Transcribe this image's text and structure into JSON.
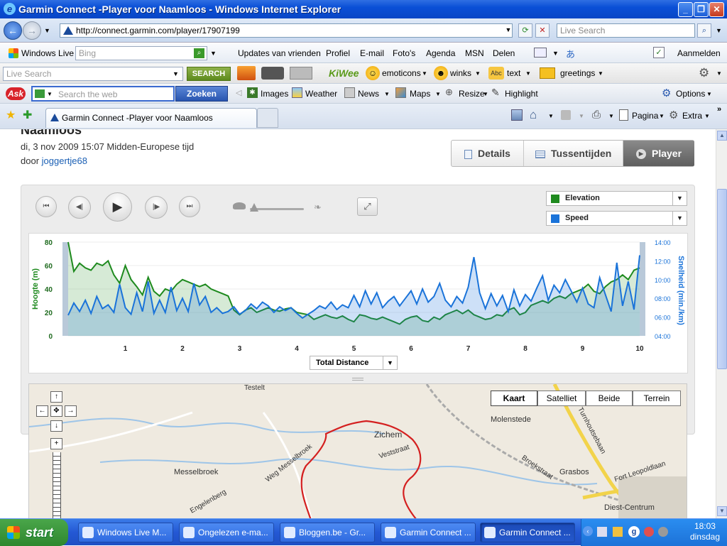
{
  "window": {
    "title": "Garmin Connect -Player voor Naamloos - Windows Internet Explorer"
  },
  "browser": {
    "url": "http://connect.garmin.com/player/17907199",
    "live_search_placeholder": "Live Search",
    "tab_title": "Garmin Connect -Player voor Naamloos"
  },
  "toolbar1": {
    "brand": "Windows Live",
    "search_placeholder": "Bing",
    "items": [
      "Updates van vrienden",
      "Profiel",
      "E-mail",
      "Foto's",
      "Agenda",
      "MSN",
      "Delen"
    ],
    "signin": "Aanmelden"
  },
  "toolbar2": {
    "search_placeholder": "Live Search",
    "search_button": "SEARCH",
    "brand": "KiWee",
    "items": [
      "emoticons",
      "winks",
      "text",
      "greetings"
    ]
  },
  "toolbar3": {
    "search_placeholder": "Search the web",
    "search_button": "Zoeken",
    "items": [
      "Images",
      "Weather",
      "News",
      "Maps",
      "Resize",
      "Highlight"
    ],
    "options": "Options"
  },
  "command_bar": {
    "items": [
      "Pagina",
      "Extra"
    ]
  },
  "activity": {
    "title_fragment": "Naamloos",
    "datetime": "di, 3 nov 2009 15:07 Midden-Europese tijd",
    "by_label": "door",
    "author": "joggertje68"
  },
  "view_tabs": [
    "Details",
    "Tussentijden",
    "Player"
  ],
  "player": {
    "series_selects": [
      {
        "label": "Elevation",
        "color": "#1e8a1e"
      },
      {
        "label": "Speed",
        "color": "#1a73d9"
      }
    ],
    "x_axis_select": "Total Distance"
  },
  "chart_data": {
    "type": "area",
    "x": [
      0,
      0.1,
      0.2,
      0.3,
      0.4,
      0.5,
      0.6,
      0.7,
      0.8,
      0.9,
      1.0,
      1.1,
      1.2,
      1.3,
      1.4,
      1.5,
      1.6,
      1.7,
      1.8,
      1.9,
      2.0,
      2.1,
      2.2,
      2.3,
      2.4,
      2.5,
      2.6,
      2.7,
      2.8,
      2.9,
      3.0,
      3.1,
      3.2,
      3.3,
      3.4,
      3.5,
      3.6,
      3.7,
      3.8,
      3.9,
      4.0,
      4.1,
      4.2,
      4.3,
      4.4,
      4.5,
      4.6,
      4.7,
      4.8,
      4.9,
      5.0,
      5.1,
      5.2,
      5.3,
      5.4,
      5.5,
      5.6,
      5.7,
      5.8,
      5.9,
      6.0,
      6.1,
      6.2,
      6.3,
      6.4,
      6.5,
      6.6,
      6.7,
      6.8,
      6.9,
      7.0,
      7.1,
      7.2,
      7.3,
      7.4,
      7.5,
      7.6,
      7.7,
      7.8,
      7.9,
      8.0,
      8.1,
      8.2,
      8.3,
      8.4,
      8.5,
      8.6,
      8.7,
      8.8,
      8.9,
      9.0,
      9.1,
      9.2,
      9.3,
      9.4,
      9.5,
      9.6,
      9.7,
      9.8,
      9.9,
      10.0
    ],
    "series": [
      {
        "name": "Elevation",
        "axis": "left",
        "color": "#1e8a1e",
        "values": [
          80,
          55,
          62,
          58,
          56,
          62,
          60,
          64,
          52,
          45,
          60,
          48,
          42,
          35,
          50,
          38,
          34,
          40,
          38,
          44,
          48,
          46,
          44,
          42,
          44,
          40,
          38,
          36,
          34,
          22,
          18,
          22,
          24,
          20,
          22,
          24,
          22,
          21,
          23,
          24,
          20,
          19,
          18,
          14,
          16,
          18,
          16,
          15,
          17,
          14,
          12,
          18,
          17,
          15,
          14,
          16,
          14,
          12,
          10,
          14,
          16,
          17,
          13,
          12,
          16,
          14,
          18,
          20,
          22,
          19,
          22,
          18,
          16,
          14,
          15,
          18,
          17,
          22,
          24,
          18,
          20,
          26,
          28,
          30,
          28,
          32,
          34,
          32,
          36,
          38,
          40,
          44,
          38,
          36,
          42,
          46,
          48,
          52,
          48,
          56,
          58
        ]
      },
      {
        "name": "Speed",
        "axis": "right",
        "color": "#1a73d9",
        "values": [
          6.2,
          7.5,
          6.6,
          7.8,
          6.4,
          8.2,
          6.9,
          7.3,
          6.5,
          9.5,
          7.0,
          6.3,
          8.6,
          6.6,
          9.8,
          6.4,
          7.8,
          6.5,
          9.2,
          6.7,
          8.0,
          6.6,
          9.6,
          7.3,
          8.2,
          6.5,
          7.0,
          6.4,
          6.6,
          7.1,
          6.3,
          6.7,
          7.4,
          6.9,
          7.6,
          7.2,
          6.5,
          7.1,
          6.7,
          7.0,
          6.4,
          5.9,
          6.3,
          6.7,
          7.2,
          6.9,
          7.6,
          6.8,
          7.3,
          7.0,
          8.3,
          7.1,
          8.8,
          7.4,
          8.6,
          7.0,
          7.7,
          8.2,
          7.2,
          8.0,
          8.8,
          7.4,
          9.0,
          7.6,
          8.2,
          9.6,
          7.8,
          7.1,
          8.2,
          7.5,
          9.2,
          12.4,
          8.6,
          6.9,
          8.5,
          7.2,
          8.3,
          6.6,
          8.9,
          7.2,
          8.4,
          7.7,
          9.1,
          10.4,
          7.8,
          9.4,
          8.6,
          10.0,
          8.8,
          7.6,
          9.1,
          7.4,
          7.0,
          10.2,
          8.4,
          6.6,
          11.8,
          7.2,
          9.8,
          6.8,
          12.6
        ]
      }
    ],
    "xlabel": "Total Distance",
    "ylabel": "Hoogte (m)",
    "y2label": "Snelheid (min./km)",
    "xlim": [
      0,
      10
    ],
    "ylim": [
      0,
      80
    ],
    "y2lim": [
      4,
      14
    ],
    "xticks": [
      "1",
      "2",
      "3",
      "4",
      "5",
      "6",
      "7",
      "8",
      "9",
      "10"
    ],
    "yticks": [
      "0",
      "20",
      "40",
      "60",
      "80"
    ],
    "y2ticks": [
      "04:00",
      "06:00",
      "08:00",
      "10:00",
      "12:00",
      "14:00"
    ]
  },
  "map": {
    "types": [
      "Kaart",
      "Satelliet",
      "Beide",
      "Terrein"
    ],
    "places": [
      "Testelt",
      "Zichem",
      "Molenstede",
      "Messelbroek",
      "Grasbos",
      "Diest-Centrum",
      "Fort Leopoldlaan",
      "Turnhoutsebaan",
      "Weg Messelbroek",
      "Veststraat",
      "Broekstraat",
      "Engelenberg"
    ]
  },
  "taskbar": {
    "start": "start",
    "tasks": [
      "Windows Live M...",
      "Ongelezen e-ma...",
      "Bloggen.be - Gr...",
      "Garmin Connect ...",
      "Garmin Connect ..."
    ],
    "time": "18:03",
    "day": "dinsdag"
  }
}
